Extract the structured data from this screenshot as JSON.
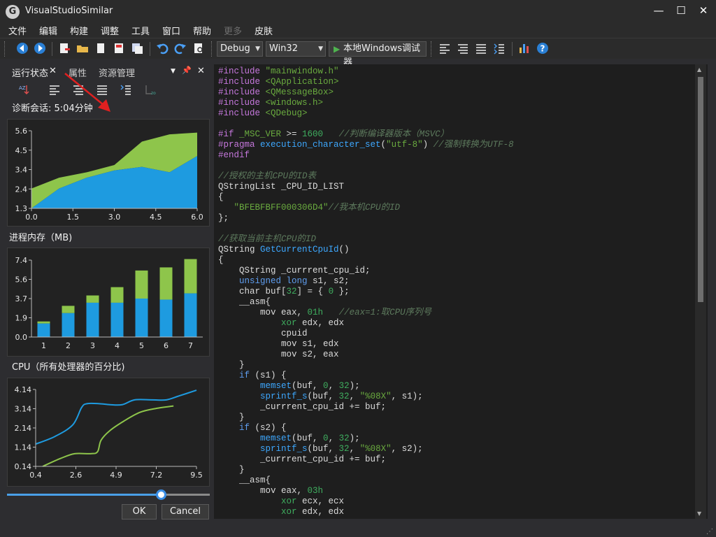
{
  "app": {
    "title": "VisualStudioSimilar"
  },
  "window_controls": {
    "minimize": "—",
    "maximize": "☐",
    "close": "✕"
  },
  "menu": [
    "文件",
    "编辑",
    "构建",
    "调整",
    "工具",
    "窗口",
    "帮助",
    "更多",
    "皮肤"
  ],
  "toolbar": {
    "config_value": "Debug",
    "platform_value": "Win32",
    "run_label": "本地Windows调试器"
  },
  "panel": {
    "tabs": [
      "运行状态",
      "属性",
      "资源管理"
    ],
    "tab_close": "✕",
    "pin": "📌",
    "close": "✕",
    "dropdown": "▼",
    "session_label": "诊断会话:",
    "session_value": "5:04分钟",
    "memory_title": "进程内存（MB)",
    "cpu_title": "CPU（所有处理器的百分比)",
    "ok_label": "OK",
    "cancel_label": "Cancel",
    "slider_value": 0.76
  },
  "chart_data": [
    {
      "type": "area",
      "x": [
        0,
        1,
        2,
        3,
        4,
        5,
        6
      ],
      "xticks": [
        "0.0",
        "1.5",
        "3.0",
        "4.5",
        "6.0"
      ],
      "yticks": [
        "1.3",
        "2.4",
        "3.4",
        "4.5",
        "5.6"
      ],
      "xlim": [
        0,
        6
      ],
      "ylim": [
        1.3,
        5.6
      ],
      "series": [
        {
          "values": [
            1.3,
            2.4,
            3.0,
            3.4,
            3.6,
            3.3,
            4.2
          ],
          "color": "#1e9be0"
        },
        {
          "values": [
            2.4,
            3.0,
            3.3,
            3.7,
            5.0,
            5.4,
            5.5
          ],
          "color": "#8ec54b"
        }
      ]
    },
    {
      "type": "bar",
      "stacked": true,
      "categories": [
        "1",
        "2",
        "3",
        "4",
        "5",
        "6",
        "7"
      ],
      "yticks": [
        "0.0",
        "1.9",
        "3.7",
        "5.6",
        "7.4"
      ],
      "ylim": [
        0,
        7.4
      ],
      "series": [
        {
          "values": [
            1.3,
            2.3,
            3.3,
            3.3,
            3.7,
            3.6,
            4.2
          ],
          "color": "#1e9be0"
        },
        {
          "values": [
            0.2,
            0.7,
            0.7,
            1.5,
            2.7,
            3.1,
            3.3
          ],
          "color": "#8ec54b"
        }
      ]
    },
    {
      "type": "line",
      "xticks": [
        "0.4",
        "2.6",
        "4.9",
        "7.2",
        "9.5"
      ],
      "yticks": [
        "0.14",
        "1.14",
        "2.14",
        "3.14",
        "4.14"
      ],
      "xlim": [
        0.4,
        9.5
      ],
      "ylim": [
        0.14,
        4.14
      ],
      "series": [
        {
          "x": [
            0.4,
            1.5,
            2.5,
            3.0,
            3.3,
            4.0,
            4.6,
            5.3,
            6.0,
            7.0,
            7.8,
            8.5,
            9.5
          ],
          "y": [
            1.3,
            1.7,
            2.3,
            3.2,
            3.4,
            3.4,
            3.35,
            3.35,
            3.6,
            3.6,
            3.6,
            3.8,
            4.1
          ],
          "color": "#1e9be0"
        },
        {
          "x": [
            0.8,
            1.8,
            2.6,
            3.5,
            3.9,
            4.1,
            4.6,
            5.4,
            6.3,
            7.2,
            8.2
          ],
          "y": [
            0.14,
            0.55,
            0.8,
            0.8,
            0.9,
            1.5,
            2.0,
            2.5,
            2.95,
            3.15,
            3.28
          ],
          "color": "#8ec54b"
        }
      ]
    }
  ],
  "editor": {
    "lines": [
      [
        [
          "#include ",
          "kw2"
        ],
        [
          "\"mainwindow.h\"",
          "str"
        ]
      ],
      [
        [
          "#include ",
          "kw2"
        ],
        [
          "<QApplication>",
          "str"
        ]
      ],
      [
        [
          "#include ",
          "kw2"
        ],
        [
          "<QMessageBox>",
          "str"
        ]
      ],
      [
        [
          "#include ",
          "kw2"
        ],
        [
          "<windows.h>",
          "str"
        ]
      ],
      [
        [
          "#include ",
          "kw2"
        ],
        [
          "<QDebug>",
          "str"
        ]
      ],
      [],
      [
        [
          "#if ",
          "kw2"
        ],
        [
          "_MSC_VER ",
          "str"
        ],
        [
          ">= ",
          "pl"
        ],
        [
          "1600",
          "num"
        ],
        [
          "   ",
          "pl"
        ],
        [
          "//判断编译器版本（MSVC）",
          "com"
        ]
      ],
      [
        [
          "#pragma ",
          "kw2"
        ],
        [
          "execution_character_set",
          "fn"
        ],
        [
          "(",
          "pl"
        ],
        [
          "\"utf-8\"",
          "str"
        ],
        [
          ") ",
          "pl"
        ],
        [
          "//强制转换为UTF-8",
          "com"
        ]
      ],
      [
        [
          "#endif",
          "kw2"
        ]
      ],
      [],
      [
        [
          "//授权的主机CPU的ID表",
          "com"
        ]
      ],
      [
        [
          "QStringList _CPU_ID_LIST",
          "pl"
        ]
      ],
      [
        [
          "{",
          "pl"
        ]
      ],
      [
        [
          "   ",
          "pl"
        ],
        [
          "\"BFEBFBFF000306D4\"",
          "str"
        ],
        [
          "//我本机CPU的ID",
          "com"
        ]
      ],
      [
        [
          "};",
          "pl"
        ]
      ],
      [],
      [
        [
          "//获取当前主机CPU的ID",
          "com"
        ]
      ],
      [
        [
          "QString ",
          "pl"
        ],
        [
          "GetCurrentCpuId",
          "fn"
        ],
        [
          "()",
          "pl"
        ]
      ],
      [
        [
          "{",
          "pl"
        ]
      ],
      [
        [
          "    QString _currrent_cpu_id;",
          "pl"
        ]
      ],
      [
        [
          "    ",
          "pl"
        ],
        [
          "unsigned long",
          "kw"
        ],
        [
          " s1, s2;",
          "pl"
        ]
      ],
      [
        [
          "    char buf[",
          "pl"
        ],
        [
          "32",
          "num"
        ],
        [
          "] = { ",
          "pl"
        ],
        [
          "0",
          "num"
        ],
        [
          " };",
          "pl"
        ]
      ],
      [
        [
          "    __asm{",
          "pl"
        ]
      ],
      [
        [
          "        mov eax, ",
          "pl"
        ],
        [
          "01h",
          "num"
        ],
        [
          "   ",
          "pl"
        ],
        [
          "//eax=1:取CPU序列号",
          "com"
        ]
      ],
      [
        [
          "            ",
          "pl"
        ],
        [
          "xor",
          "num"
        ],
        [
          " edx, edx",
          "pl"
        ]
      ],
      [
        [
          "            cpuid",
          "pl"
        ]
      ],
      [
        [
          "            mov s1, edx",
          "pl"
        ]
      ],
      [
        [
          "            mov s2, eax",
          "pl"
        ]
      ],
      [
        [
          "    }",
          "pl"
        ]
      ],
      [
        [
          "    ",
          "pl"
        ],
        [
          "if",
          "kw"
        ],
        [
          " (s1) {",
          "pl"
        ]
      ],
      [
        [
          "        ",
          "pl"
        ],
        [
          "memset",
          "fn"
        ],
        [
          "(buf, ",
          "pl"
        ],
        [
          "0",
          "num"
        ],
        [
          ", ",
          "pl"
        ],
        [
          "32",
          "num"
        ],
        [
          ");",
          "pl"
        ]
      ],
      [
        [
          "        ",
          "pl"
        ],
        [
          "sprintf_s",
          "fn"
        ],
        [
          "(buf, ",
          "pl"
        ],
        [
          "32",
          "num"
        ],
        [
          ", ",
          "pl"
        ],
        [
          "\"%08X\"",
          "str"
        ],
        [
          ", s1);",
          "pl"
        ]
      ],
      [
        [
          "        _currrent_cpu_id += buf;",
          "pl"
        ]
      ],
      [
        [
          "    }",
          "pl"
        ]
      ],
      [
        [
          "    ",
          "pl"
        ],
        [
          "if",
          "kw"
        ],
        [
          " (s2) {",
          "pl"
        ]
      ],
      [
        [
          "        ",
          "pl"
        ],
        [
          "memset",
          "fn"
        ],
        [
          "(buf, ",
          "pl"
        ],
        [
          "0",
          "num"
        ],
        [
          ", ",
          "pl"
        ],
        [
          "32",
          "num"
        ],
        [
          ");",
          "pl"
        ]
      ],
      [
        [
          "        ",
          "pl"
        ],
        [
          "sprintf_s",
          "fn"
        ],
        [
          "(buf, ",
          "pl"
        ],
        [
          "32",
          "num"
        ],
        [
          ", ",
          "pl"
        ],
        [
          "\"%08X\"",
          "str"
        ],
        [
          ", s2);",
          "pl"
        ]
      ],
      [
        [
          "        _currrent_cpu_id += buf;",
          "pl"
        ]
      ],
      [
        [
          "    }",
          "pl"
        ]
      ],
      [
        [
          "    __asm{",
          "pl"
        ]
      ],
      [
        [
          "        mov eax, ",
          "pl"
        ],
        [
          "03h",
          "num"
        ]
      ],
      [
        [
          "            ",
          "pl"
        ],
        [
          "xor",
          "num"
        ],
        [
          " ecx, ecx",
          "pl"
        ]
      ],
      [
        [
          "            ",
          "pl"
        ],
        [
          "xor",
          "num"
        ],
        [
          " edx, edx",
          "pl"
        ]
      ]
    ]
  },
  "colors": {
    "blue": "#1e9be0",
    "green": "#8ec54b",
    "keyword": "#5f9ef0",
    "keyword2": "#c678dd",
    "string": "#6aab3f",
    "number": "#3fae5f",
    "comment": "#5d7a5d",
    "function": "#3da8ff",
    "plain": "#dcdcdc"
  },
  "icons": [
    "back-icon",
    "forward-icon",
    "new-file-icon",
    "open-folder-icon",
    "file-icon",
    "save-icon",
    "save-all-icon",
    "undo-icon",
    "redo-icon",
    "find-icon",
    "align-left-icon",
    "align-center-icon",
    "align-right-icon",
    "indent-icon",
    "chart-icon",
    "help-icon"
  ]
}
